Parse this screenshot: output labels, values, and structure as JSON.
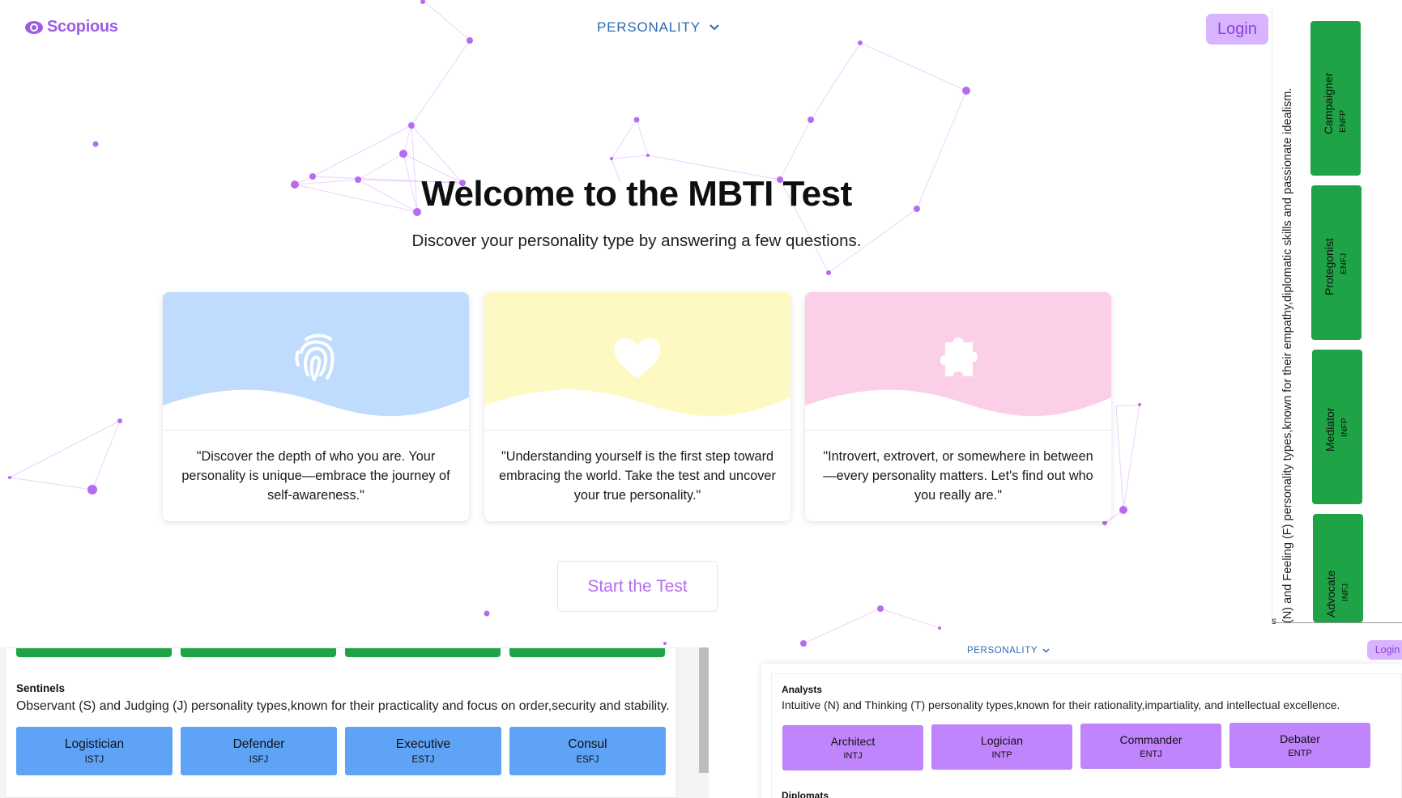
{
  "header": {
    "logo_text": "Scopious",
    "nav_dropdown_label": "PERSONALITY",
    "login_label": "Login"
  },
  "hero": {
    "title": "Welcome to the MBTI Test",
    "subtitle": "Discover your personality type by answering a few questions."
  },
  "cards": [
    {
      "icon": "fingerprint-icon",
      "color": "#bfdbfe",
      "quote": "\"Discover the depth of who you are. Your personality is unique—embrace the journey of self-awareness.\""
    },
    {
      "icon": "heart-icon",
      "color": "#fef9c3",
      "quote": "\"Understanding yourself is the first step toward embracing the world. Take the test and uncover your true personality.\""
    },
    {
      "icon": "puzzle-icon",
      "color": "#fbcfe8",
      "quote": "\"Introvert, extrovert, or somewhere in between—every personality matters. Let's find out who you really are.\""
    }
  ],
  "start_button_label": "Start the Test",
  "right_strip": {
    "description": "(N) and Feeling (F) personality types,known for their empathy,diplomatic skills and passionate idealism.",
    "edge_text": "s",
    "types": [
      {
        "name": "Campaigner",
        "code": "ENFP"
      },
      {
        "name": "Protegonist",
        "code": "ENFJ"
      },
      {
        "name": "Mediator",
        "code": "INFP"
      },
      {
        "name": "Advocate",
        "code": "INFJ"
      }
    ]
  },
  "sentinels": {
    "title": "Sentinels",
    "description": "Observant (S) and Judging (J) personality types,known for their practicality and focus on order,security and stability.",
    "types": [
      {
        "name": "Logistician",
        "code": "ISTJ"
      },
      {
        "name": "Defender",
        "code": "ISFJ"
      },
      {
        "name": "Executive",
        "code": "ESTJ"
      },
      {
        "name": "Consul",
        "code": "ESFJ"
      }
    ]
  },
  "mini_header": {
    "nav_label": "PERSONALITY",
    "login_label": "Login"
  },
  "analysts": {
    "title": "Analysts",
    "description": "Intuitive (N) and Thinking (T) personality types,known for their rationality,impartiality, and intellectual excellence.",
    "types": [
      {
        "name": "Architect",
        "code": "INTJ"
      },
      {
        "name": "Logician",
        "code": "INTP"
      },
      {
        "name": "Commander",
        "code": "ENTJ"
      },
      {
        "name": "Debater",
        "code": "ENTP"
      }
    ],
    "next_group_partial": "Diplomats"
  },
  "colors": {
    "accent_purple": "#9b5de5",
    "login_bg": "#d8b4fe",
    "nav_blue": "#2b6cb0",
    "green": "#1fa347",
    "sentinel_blue": "#5fa3f6",
    "analyst_purple": "#c084fc"
  }
}
